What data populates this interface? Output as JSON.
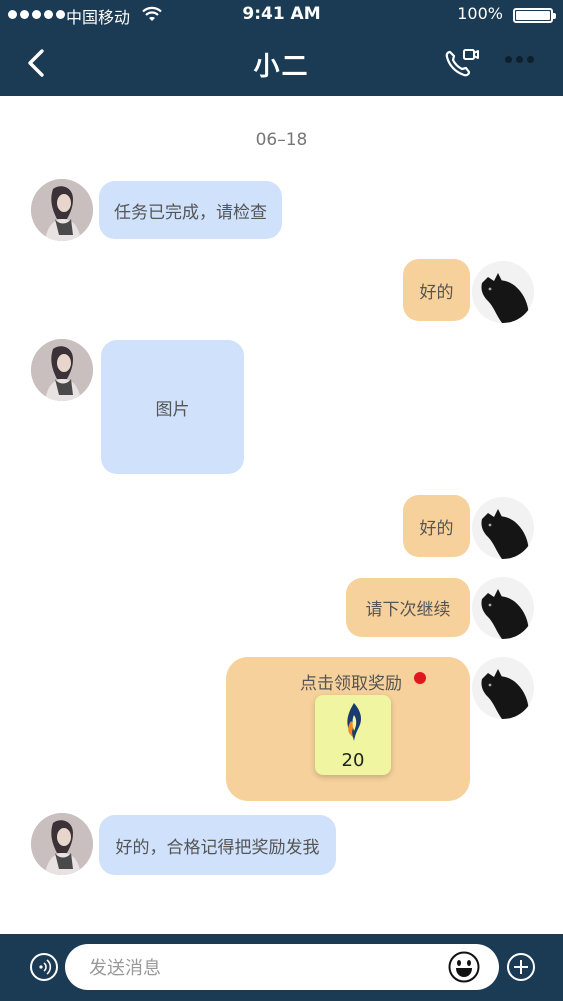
{
  "status_bar": {
    "carrier": "中国移动",
    "time": "9:41 AM",
    "battery": "100%"
  },
  "nav": {
    "title": "小二",
    "back_icon": "chevron-left-icon",
    "call_icon": "phone-video-icon",
    "more_icon": "more-dots-icon"
  },
  "date_label": "06–18",
  "messages": [
    {
      "side": "left",
      "text": "任务已完成，请检查"
    },
    {
      "side": "right",
      "text": "好的"
    },
    {
      "side": "left",
      "text": "图片"
    },
    {
      "side": "right",
      "text": "好的"
    },
    {
      "side": "right",
      "text": "请下次继续"
    },
    {
      "side": "left",
      "text": "好的，合格记得把奖励发我"
    }
  ],
  "reward": {
    "label": "点击领取奖励",
    "amount": "20"
  },
  "input_bar": {
    "placeholder": "发送消息",
    "voice_icon": "voice-icon",
    "emoji_icon": "emoji-icon",
    "plus_icon": "plus-icon"
  },
  "colors": {
    "bar": "#1b3a54",
    "bubble_left": "#cfe1fb",
    "bubble_right": "#f6d19b",
    "coupon": "#eff5a1",
    "dot": "#e0171f"
  }
}
